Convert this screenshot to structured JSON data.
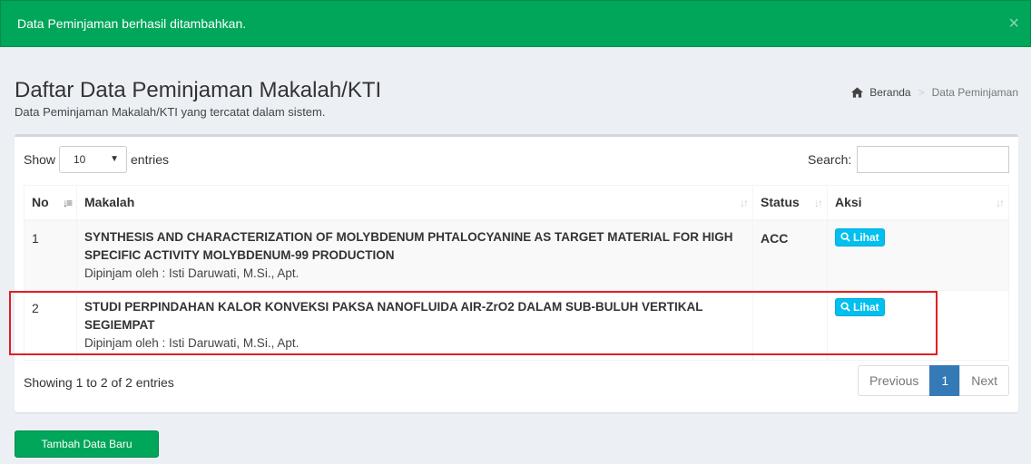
{
  "alert": {
    "message": "Data Peminjaman berhasil ditambahkan.",
    "close_glyph": "×"
  },
  "header": {
    "title": "Daftar Data Peminjaman Makalah/KTI",
    "subtitle": "Data Peminjaman Makalah/KTI yang tercatat dalam sistem."
  },
  "breadcrumb": {
    "home": "Beranda",
    "separator": ">",
    "current": "Data Peminjaman"
  },
  "table_controls": {
    "show_label": "Show",
    "entries_value": "10",
    "entries_label": "entries",
    "search_label": "Search:",
    "search_value": ""
  },
  "table": {
    "columns": [
      "No",
      "Makalah",
      "Status",
      "Aksi"
    ],
    "rows": [
      {
        "no": "1",
        "title": "SYNTHESIS AND CHARACTERIZATION OF MOLYBDENUM PHTALOCYANINE AS TARGET MATERIAL FOR HIGH SPECIFIC ACTIVITY MOLYBDENUM-99 PRODUCTION",
        "borrower": "Dipinjam oleh : Isti Daruwati, M.Si., Apt.",
        "status": "ACC",
        "action": "Lihat"
      },
      {
        "no": "2",
        "title": "STUDI PERPINDAHAN KALOR KONVEKSI PAKSA NANOFLUIDA AIR-ZrO2 DALAM SUB-BULUH VERTIKAL SEGIEMPAT",
        "borrower": "Dipinjam oleh : Isti Daruwati, M.Si., Apt.",
        "status": "",
        "action": "Lihat"
      }
    ]
  },
  "footer": {
    "info": "Showing 1 to 2 of 2 entries",
    "pagination": {
      "previous": "Previous",
      "current": "1",
      "next": "Next"
    }
  },
  "add_button": "Tambah Data Baru",
  "colors": {
    "success": "#00a65a",
    "info": "#00c0ef",
    "primary": "#337ab7",
    "highlight": "#e02020"
  }
}
